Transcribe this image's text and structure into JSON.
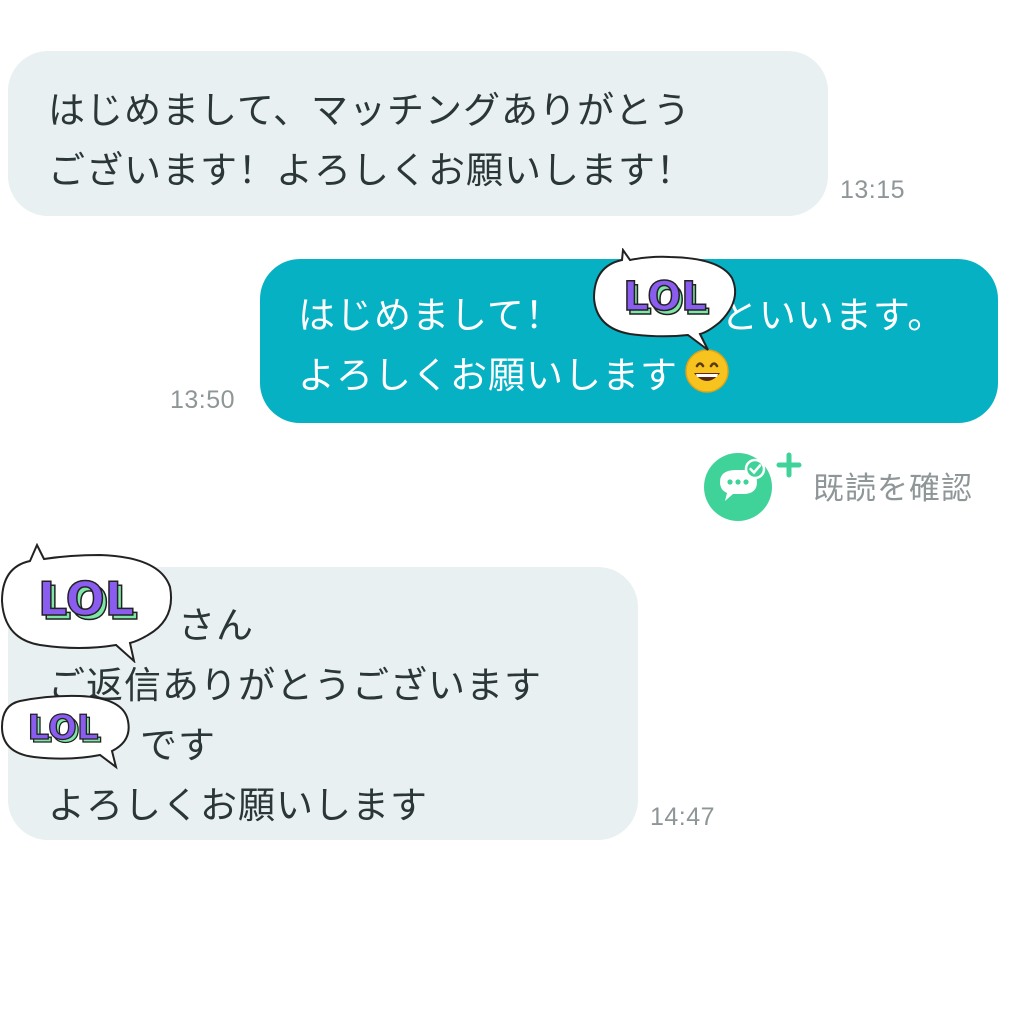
{
  "messages": [
    {
      "direction": "incoming",
      "lines": [
        "はじめまして、マッチングありがとう",
        "ございます！よろしくお願いします！"
      ],
      "time": "13:15"
    },
    {
      "direction": "outgoing",
      "lines": [
        "はじめまして！",
        "といいます。",
        "よろしくお願いします"
      ],
      "time": "13:50",
      "emoji_icon": "grinning-face-emoji",
      "sticker_icon": "lol-sticker-icon"
    },
    {
      "direction": "incoming",
      "lines": [
        "さん",
        "ご返信ありがとうございます",
        "です",
        "よろしくお願いします"
      ],
      "time": "14:47",
      "sticker_icon": "lol-sticker-icon"
    }
  ],
  "read_receipt": {
    "label": "既読を確認",
    "icon": "chat-check-plus-icon"
  },
  "sticker_text": "LOL",
  "colors": {
    "incoming_bubble": "#e9f0f1",
    "outgoing_bubble": "#06b1c4",
    "read_icon": "#3fd39a",
    "sticker_purple": "#8a5cf0",
    "sticker_green": "#7ee6a6"
  }
}
